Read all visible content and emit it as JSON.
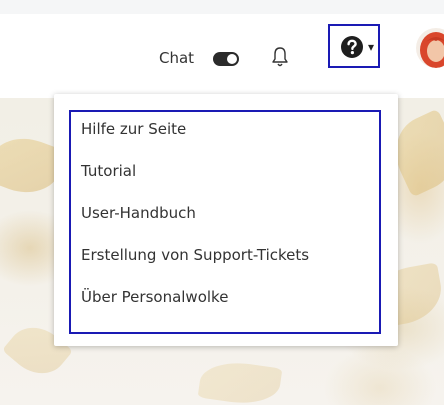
{
  "header": {
    "chat_label": "Chat",
    "chat_toggle_state": "on",
    "help_caret": "▾"
  },
  "help_menu": {
    "items": [
      {
        "label": "Hilfe zur Seite"
      },
      {
        "label": "Tutorial"
      },
      {
        "label": "User-Handbuch"
      },
      {
        "label": "Erstellung von Support-Tickets"
      },
      {
        "label": "Über Personalwolke"
      }
    ]
  },
  "colors": {
    "highlight_border": "#1a1ab4",
    "text": "#333333",
    "avatar_hair": "#d9462b"
  },
  "icons": [
    "toggle-icon",
    "bell-icon",
    "help-circle-icon",
    "chevron-down-icon",
    "avatar"
  ]
}
